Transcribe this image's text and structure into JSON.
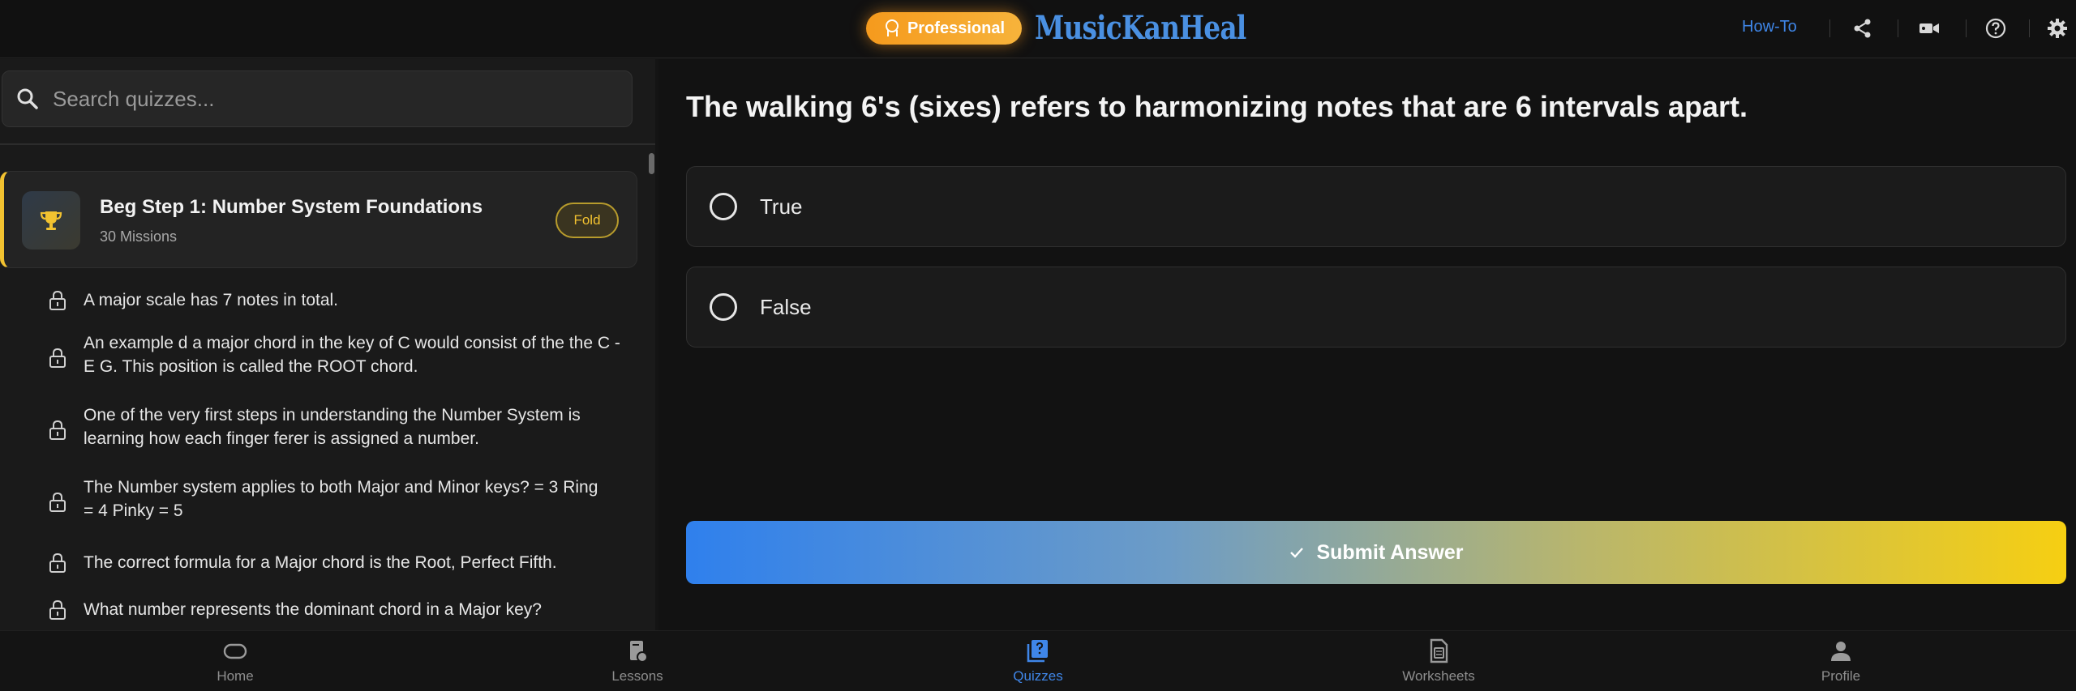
{
  "header": {
    "badge_label": "Professional",
    "logo_text": "MusicKanHeal",
    "howto_label": "How-To",
    "icons": [
      "share-icon",
      "video-icon",
      "help-icon",
      "settings-icon"
    ]
  },
  "sidebar": {
    "search_placeholder": "Search quizzes...",
    "step": {
      "title": "Beg Step 1: Number System Foundations",
      "subtitle": "30 Missions",
      "fold_label": "Fold",
      "accent_color": "#f2c230"
    },
    "missions": [
      {
        "text": "A major scale has 7 notes in total."
      },
      {
        "text": "An example d a major chord in the key of C would consist of the the C - E G. This position is called the ROOT chord."
      },
      {
        "text": "One of the very first steps in understanding the Number System is learning how each finger ferer is assigned a number."
      },
      {
        "text": "The Number system applies to both Major and Minor keys? = 3 Ring = 4 Pinky = 5"
      },
      {
        "text": "The correct formula for a Major chord is the Root, Perfect Fifth."
      },
      {
        "text": "What number represents the dominant chord in a Major key?"
      }
    ]
  },
  "main": {
    "question": "The walking 6's (sixes) refers to harmonizing notes that are 6 intervals apart.",
    "options": [
      {
        "label": "True",
        "selected": false
      },
      {
        "label": "False",
        "selected": false
      }
    ],
    "submit_label": "Submit Answer"
  },
  "bottom_nav": {
    "items": [
      {
        "label": "Home",
        "icon": "home-icon",
        "active": false
      },
      {
        "label": "Lessons",
        "icon": "lessons-icon",
        "active": false
      },
      {
        "label": "Quizzes",
        "icon": "quizzes-icon",
        "active": true
      },
      {
        "label": "Worksheets",
        "icon": "worksheets-icon",
        "active": false
      },
      {
        "label": "Profile",
        "icon": "profile-icon",
        "active": false
      }
    ]
  },
  "colors": {
    "accent_blue": "#3f86e8",
    "accent_yellow": "#f2c230",
    "badge_orange": "#f59a1d"
  }
}
